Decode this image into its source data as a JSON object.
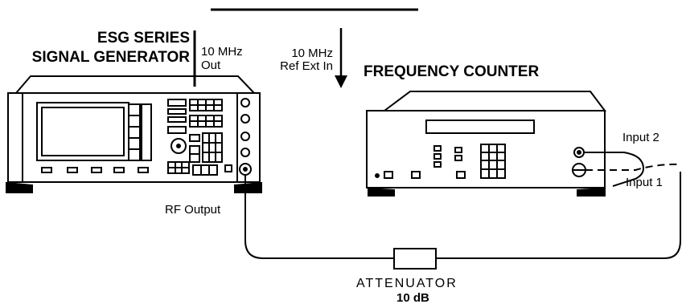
{
  "signal_generator": {
    "title_line1": "ESG SERIES",
    "title_line2": "SIGNAL GENERATOR",
    "ref_out_line1": "10 MHz",
    "ref_out_line2": "Out",
    "rf_output": "RF Output"
  },
  "frequency_counter": {
    "ref_in_line1": "10 MHz",
    "ref_in_line2": "Ref Ext In",
    "title": "FREQUENCY COUNTER",
    "input2": "Input 2",
    "input1": "Input 1"
  },
  "attenuator": {
    "label": "ATTENUATOR",
    "value": "10 dB"
  }
}
